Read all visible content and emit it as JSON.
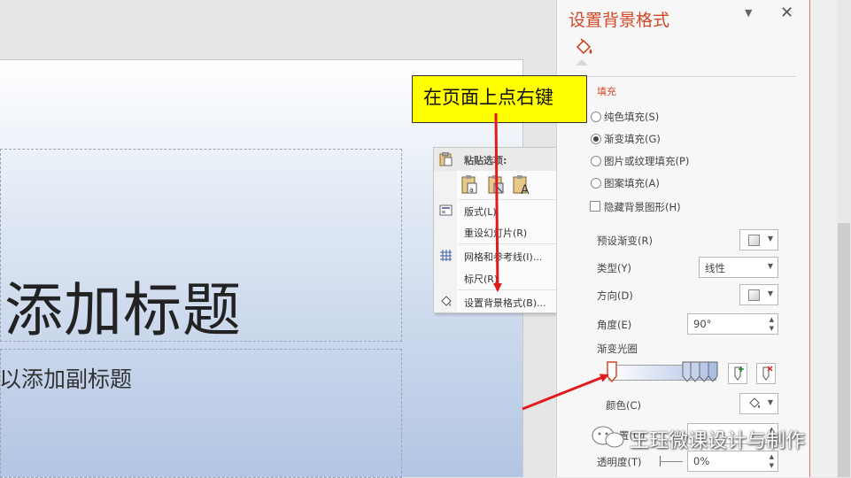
{
  "slide": {
    "title": "添加标题",
    "subtitle": "以添加副标题"
  },
  "callout": {
    "text": "在页面上点右键"
  },
  "context_menu": {
    "paste_header": "粘贴选项:",
    "items": [
      {
        "label": "版式(L)",
        "has_submenu": true,
        "icon": "layout-icon"
      },
      {
        "label": "重设幻灯片(R)",
        "has_submenu": false,
        "icon": ""
      },
      {
        "label": "网格和参考线(I)...",
        "has_submenu": true,
        "icon": "grid-icon"
      },
      {
        "label": "标尺(R)",
        "has_submenu": false,
        "icon": ""
      },
      {
        "label": "设置背景格式(B)...",
        "has_submenu": false,
        "icon": "format-background-icon"
      }
    ]
  },
  "pane": {
    "title": "设置背景格式",
    "section": "填充",
    "options": [
      {
        "label": "纯色填充(S)",
        "selected": false
      },
      {
        "label": "渐变填充(G)",
        "selected": true
      },
      {
        "label": "图片或纹理填充(P)",
        "selected": false
      },
      {
        "label": "图案填充(A)",
        "selected": false
      }
    ],
    "hide_graphics_label": "隐藏背景图形(H)",
    "preset_label": "预设渐变(R)",
    "type_label": "类型(Y)",
    "type_value": "线性",
    "direction_label": "方向(D)",
    "angle_label": "角度(E)",
    "angle_value": "90°",
    "stops_label": "渐变光圈",
    "color_label": "颜色(C)",
    "position_label": "置(O)",
    "transparency_label": "透明度(T)",
    "transparency_value": "0%"
  },
  "watermark": {
    "text": "王珏微课设计与制作"
  },
  "colors": {
    "accent": "#d24726",
    "callout": "#ffff00",
    "arrow": "#e11b1b"
  }
}
